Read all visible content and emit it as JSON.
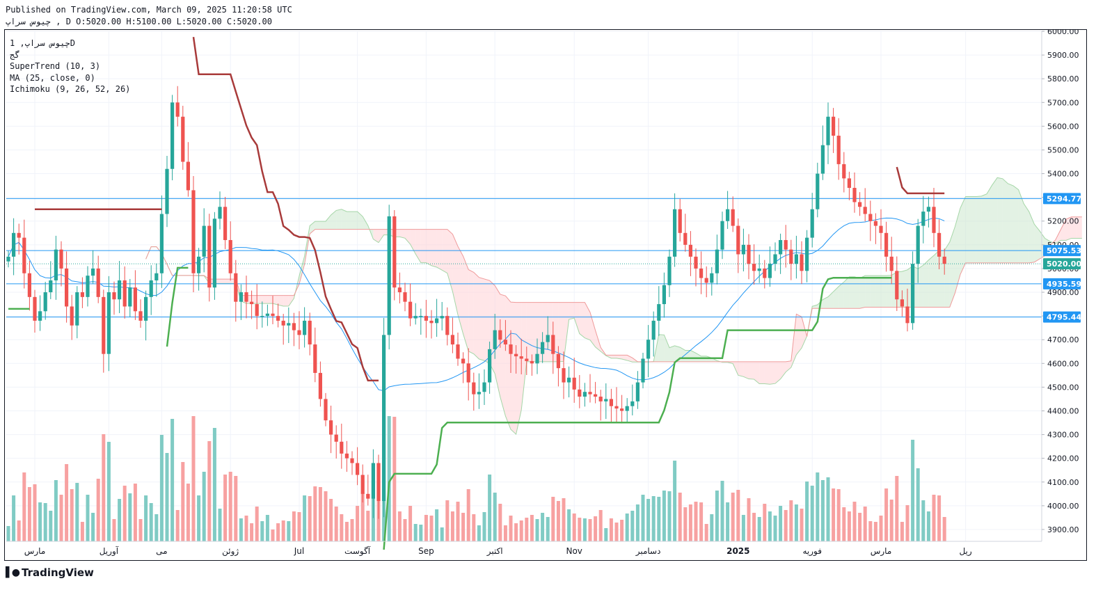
{
  "header": {
    "published": "Published on TradingView.com, March 09, 2025 11:20:58 UTC",
    "ohlc": "چیوس سراپ , D O:5020.00 H:5100.00 L:5020.00 C:5020.00"
  },
  "legend": {
    "symbol": "چیوس سراپ, 1D",
    "sub": "گج",
    "indicators": [
      "SuperTrend (10, 3)",
      "MA (25, close, 0)",
      "Ichimoku (9, 26, 52, 26)"
    ]
  },
  "branding": {
    "logo_text": "TradingView",
    "logo_icon": "tradingview-logo-icon"
  },
  "colors": {
    "up": "#26a69a",
    "down": "#ef5350",
    "supertrend_up": "#4caf50",
    "supertrend_down": "#a83a3a",
    "ma": "#2196f3",
    "hline": "#2196f3",
    "cloud_bull": "#c8e6c9",
    "cloud_bear": "#ffcdd2",
    "vol_up": "#80cbc4",
    "vol_down": "#f7a1a1"
  },
  "chart_data": {
    "type": "candlestick",
    "ylim": [
      3850,
      6000
    ],
    "yticks": [
      3900,
      4000,
      4100,
      4200,
      4300,
      4400,
      4500,
      4600,
      4700,
      4800,
      4900,
      5000,
      5100,
      5200,
      5300,
      5400,
      5500,
      5600,
      5700,
      5800,
      5900,
      6000
    ],
    "yticks_visible": [
      "3900.00",
      "4000.00",
      "4100.00",
      "4200.00",
      "4300.00",
      "4400.00",
      "4500.00",
      "4600.00",
      "4700.00",
      "4800.00",
      "4900.00",
      "5000.00",
      "5100.00",
      "5200.00",
      "5300.00",
      "5400.00",
      "5500.00",
      "5600.00",
      "5700.00",
      "5800.00",
      "5900.00",
      "6000.00"
    ],
    "months": [
      {
        "label": "مارس",
        "i": 5
      },
      {
        "label": "آوریل",
        "i": 19
      },
      {
        "label": "می",
        "i": 29
      },
      {
        "label": "ژوئن",
        "i": 42
      },
      {
        "label": "Jul",
        "i": 55
      },
      {
        "label": "آگوست",
        "i": 66
      },
      {
        "label": "Sep",
        "i": 79
      },
      {
        "label": "اکتبر",
        "i": 92
      },
      {
        "label": "Nov",
        "i": 107
      },
      {
        "label": "دسامبر",
        "i": 121
      },
      {
        "label": "2025",
        "i": 138,
        "bold": true
      },
      {
        "label": "فوریه",
        "i": 152
      },
      {
        "label": "مارس",
        "i": 165
      },
      {
        "label": "ریل",
        "i": 181
      }
    ],
    "hlines": [
      {
        "value": 5294.77,
        "label": "5294.77",
        "style": "solid"
      },
      {
        "value": 5075.53,
        "label": "5075.53",
        "style": "solid"
      },
      {
        "value": 4935.59,
        "label": "4935.59",
        "style": "solid"
      },
      {
        "value": 4795.44,
        "label": "4795.44",
        "style": "solid"
      },
      {
        "value": 5020.0,
        "label": "5020.00",
        "style": "dotted"
      }
    ],
    "closes": [
      5050,
      5150,
      5130,
      4980,
      4880,
      4780,
      4820,
      4900,
      4950,
      5080,
      5000,
      4840,
      4760,
      4900,
      4880,
      4970,
      5000,
      4880,
      4640,
      4900,
      4870,
      4950,
      4840,
      4920,
      4820,
      4780,
      4880,
      4950,
      4980,
      5230,
      5420,
      5700,
      5640,
      5450,
      5330,
      4980,
      5050,
      5180,
      4920,
      5210,
      5260,
      5120,
      4980,
      4860,
      4900,
      4860,
      4850,
      4800,
      4800,
      4810,
      4800,
      4780,
      4760,
      4770,
      4740,
      4720,
      4780,
      4680,
      4560,
      4450,
      4360,
      4300,
      4270,
      4220,
      4200,
      4180,
      4130,
      4050,
      4030,
      4180,
      4020,
      4720,
      5220,
      4920,
      4900,
      4860,
      4790,
      4800,
      4800,
      4780,
      4770,
      4790,
      4800,
      4720,
      4680,
      4620,
      4600,
      4520,
      4470,
      4480,
      4520,
      4660,
      4740,
      4700,
      4680,
      4640,
      4630,
      4620,
      4610,
      4600,
      4640,
      4690,
      4720,
      4640,
      4580,
      4520,
      4540,
      4490,
      4460,
      4480,
      4470,
      4460,
      4440,
      4450,
      4420,
      4410,
      4400,
      4420,
      4440,
      4520,
      4620,
      4700,
      4780,
      4850,
      4930,
      5050,
      5250,
      5150,
      5100,
      5050,
      5000,
      4960,
      4940,
      4980,
      5080,
      5200,
      5250,
      5180,
      5060,
      5100,
      5020,
      4990,
      5000,
      4960,
      5020,
      5060,
      5120,
      5080,
      5020,
      5060,
      4990,
      5130,
      5250,
      5400,
      5520,
      5640,
      5560,
      5440,
      5380,
      5340,
      5280,
      5260,
      5230,
      5200,
      5180,
      5150,
      5050,
      4990,
      4870,
      4840,
      4770,
      5020,
      5180,
      5240,
      5260,
      5150,
      5050,
      5020
    ],
    "series": [
      {
        "name": "SuperTrend (10, 3)",
        "type": "line"
      },
      {
        "name": "MA (25, close, 0)",
        "type": "line"
      },
      {
        "name": "Ichimoku (9, 26, 52, 26)",
        "type": "cloud"
      }
    ]
  }
}
